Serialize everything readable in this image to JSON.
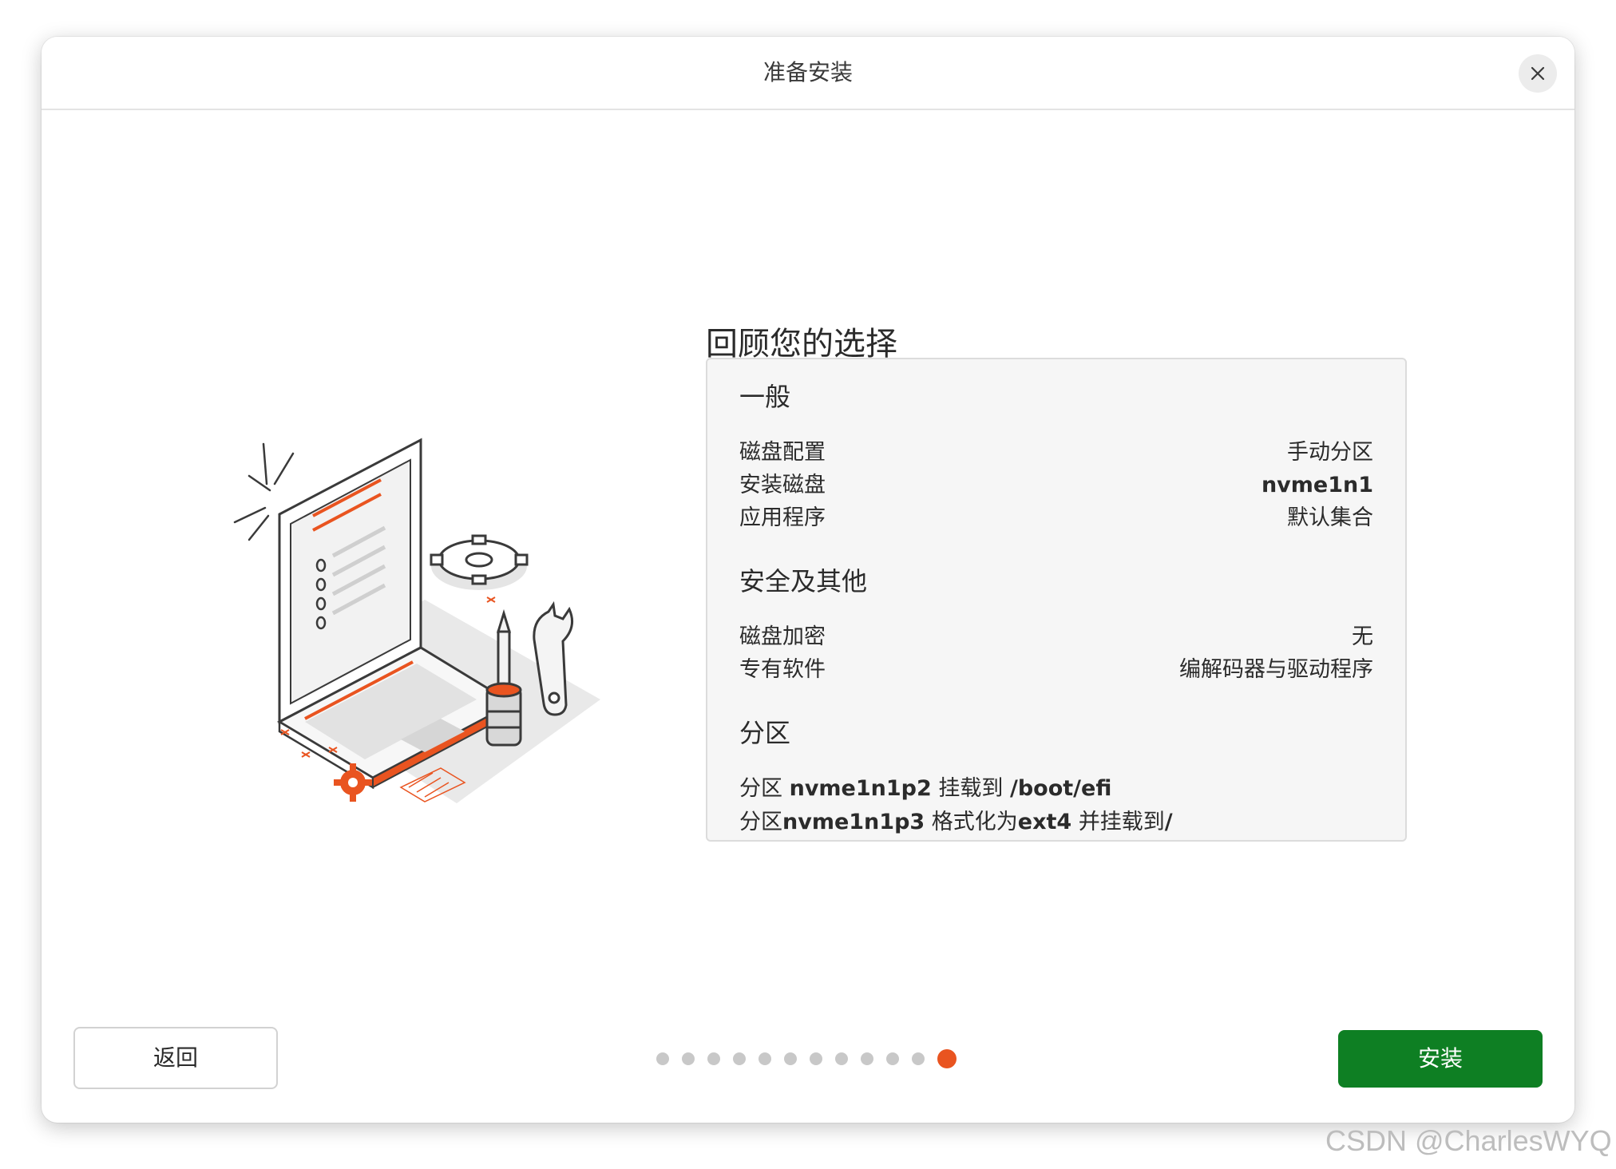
{
  "window": {
    "title": "准备安装",
    "close_icon": "close-icon"
  },
  "main": {
    "heading": "回顾您的选择",
    "general": {
      "title": "一般",
      "rows": [
        {
          "label": "磁盘配置",
          "value": "手动分区"
        },
        {
          "label": "安装磁盘",
          "value": "nvme1n1"
        },
        {
          "label": "应用程序",
          "value": "默认集合"
        }
      ]
    },
    "security": {
      "title": "安全及其他",
      "rows": [
        {
          "label": "磁盘加密",
          "value": "无"
        },
        {
          "label": "专有软件",
          "value": "编解码器与驱动程序"
        }
      ]
    },
    "partitions": {
      "title": "分区",
      "line1": {
        "pre": "分区 ",
        "dev": "nvme1n1p2",
        "mid": " 挂载到 ",
        "mount": "/boot/efi"
      },
      "line2": {
        "pre": "分区",
        "dev": "nvme1n1p3",
        "mid": " 格式化为",
        "fs": "ext4",
        "mid2": " 并挂载到",
        "mount": "/"
      }
    }
  },
  "footer": {
    "back_label": "返回",
    "install_label": "安装",
    "steps_total": 12,
    "current_step": 12
  },
  "watermark": "CSDN @CharlesWYQ",
  "colors": {
    "accent": "#e95420",
    "install_button": "#0e7f23"
  }
}
